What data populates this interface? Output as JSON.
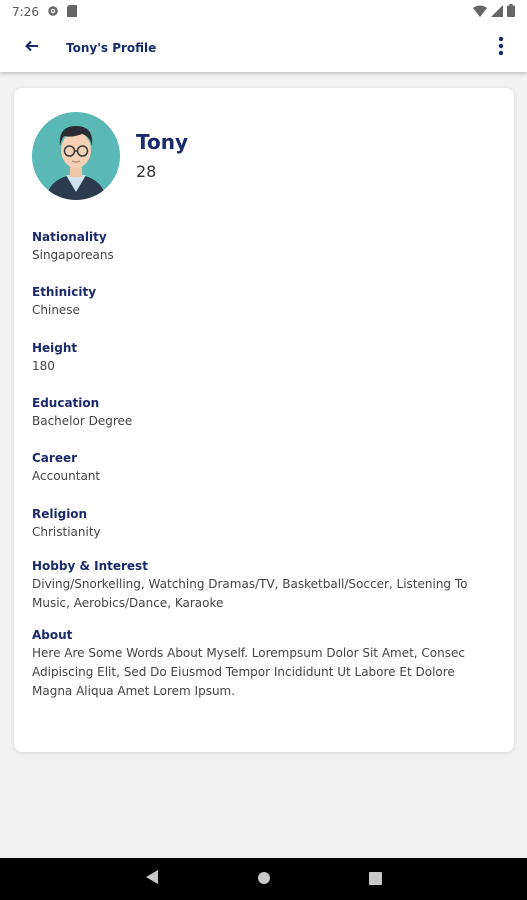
{
  "status_bar": {
    "time": "7:26"
  },
  "app_bar": {
    "title": "Tony's Profile"
  },
  "profile": {
    "name": "Tony",
    "age": "28"
  },
  "fields": [
    {
      "label": "Nationality",
      "value": "Singaporeans"
    },
    {
      "label": "Ethinicity",
      "value": "Chinese"
    },
    {
      "label": "Height",
      "value": "180"
    },
    {
      "label": "Education",
      "value": "Bachelor Degree"
    },
    {
      "label": "Career",
      "value": "Accountant"
    },
    {
      "label": "Religion",
      "value": "Christianity"
    },
    {
      "label": "Hobby & Interest",
      "value": "Diving/Snorkelling, Watching Dramas/TV, Basketball/Soccer, Listening To Music, Aerobics/Dance, Karaoke"
    },
    {
      "label": "About",
      "value": "Here Are Some Words About Myself. Lorempsum Dolor Sit Amet, Consec Adipiscing Elit, Sed Do Eiusmod Tempor Incididunt Ut Labore Et Dolore Magna Aliqua Amet Lorem Ipsum."
    }
  ],
  "icons": {
    "back": "arrow-left-icon",
    "menu": "more-vert-icon",
    "nav_back": "triangle-back-icon",
    "nav_home": "circle-home-icon",
    "nav_recents": "square-recents-icon"
  },
  "colors": {
    "accent": "#1a2a6c",
    "avatar_bg": "#5ab9b5",
    "page_bg": "#f2f2f2"
  }
}
